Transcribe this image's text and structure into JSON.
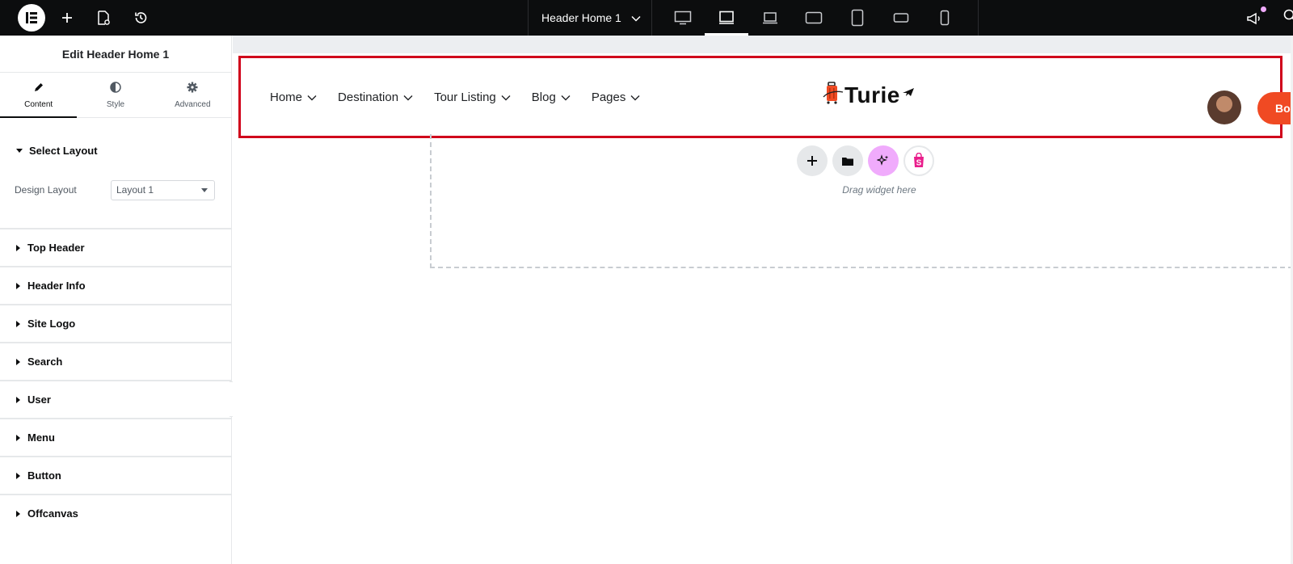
{
  "topbar": {
    "document_title": "Header Home 1",
    "icons": [
      "elementor-logo-icon",
      "add-icon",
      "page-settings-icon",
      "history-icon"
    ],
    "devices": [
      "desktop",
      "tablet",
      "laptop",
      "tablet-landscape",
      "tablet-portrait",
      "mobile-landscape",
      "mobile-portrait"
    ],
    "active_device": "tablet"
  },
  "panel": {
    "title": "Edit Header Home 1",
    "tabs": [
      {
        "label": "Content",
        "icon": "pencil-icon",
        "active": true
      },
      {
        "label": "Style",
        "icon": "half-circle-icon",
        "active": false
      },
      {
        "label": "Advanced",
        "icon": "gear-icon",
        "active": false
      }
    ],
    "open_section": {
      "title": "Select Layout",
      "control_label": "Design Layout",
      "control_value": "Layout 1"
    },
    "sections": [
      "Top Header",
      "Header Info",
      "Site Logo",
      "Search",
      "User",
      "Menu",
      "Button",
      "Offcanvas"
    ]
  },
  "preview": {
    "nav": [
      "Home",
      "Destination",
      "Tour Listing",
      "Blog",
      "Pages"
    ],
    "brand": "Turie",
    "book_button": "Boo",
    "accent_color": "#f04a23",
    "highlight_color": "#d0021b"
  },
  "dropzone": {
    "hint": "Drag widget here"
  }
}
